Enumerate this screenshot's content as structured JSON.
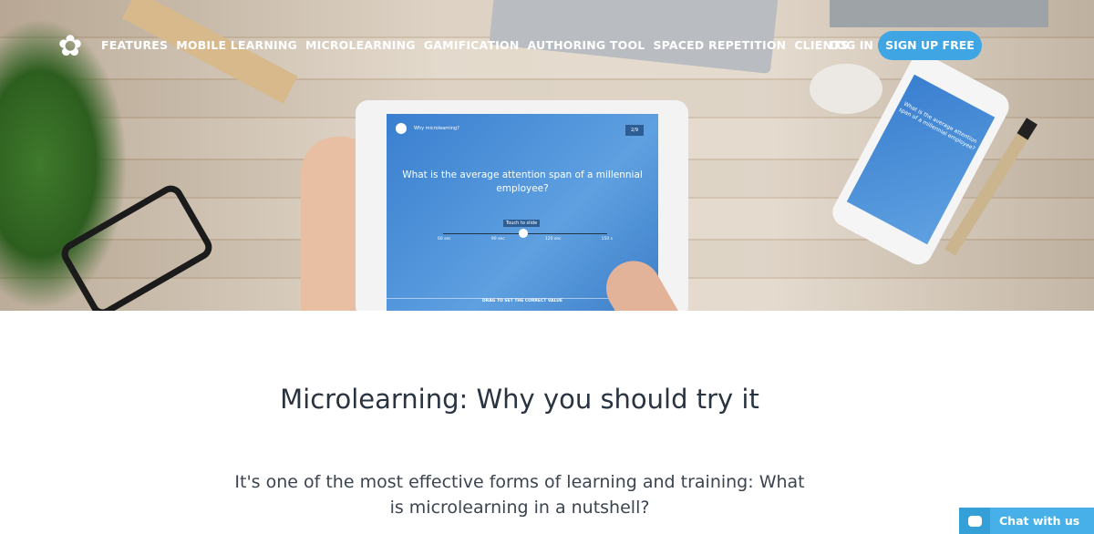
{
  "nav": {
    "items": [
      "FEATURES",
      "MOBILE LEARNING",
      "MICROLEARNING",
      "GAMIFICATION",
      "AUTHORING TOOL",
      "SPACED REPETITION",
      "CLIENTS"
    ],
    "login": "LOG IN",
    "signup": "SIGN UP FREE"
  },
  "hero": {
    "screen": {
      "header": "Why microlearning?",
      "counter": "2/9",
      "question": "What is the average attention span of a millennial employee?",
      "tooltip": "Touch to slide",
      "ticks": [
        "60 sec",
        "90 sec",
        "120 sec",
        "150 s"
      ],
      "footer": "DRAG TO SET THE CORRECT VALUE"
    }
  },
  "main": {
    "title": "Microlearning: Why you should try it",
    "subtitle": "It's one of the most effective forms of learning and training: What is microlearning in a nutshell?"
  },
  "chat": {
    "label": "Chat with us"
  },
  "colors": {
    "accent": "#3fa6e3",
    "chat": "#48b0e8"
  }
}
